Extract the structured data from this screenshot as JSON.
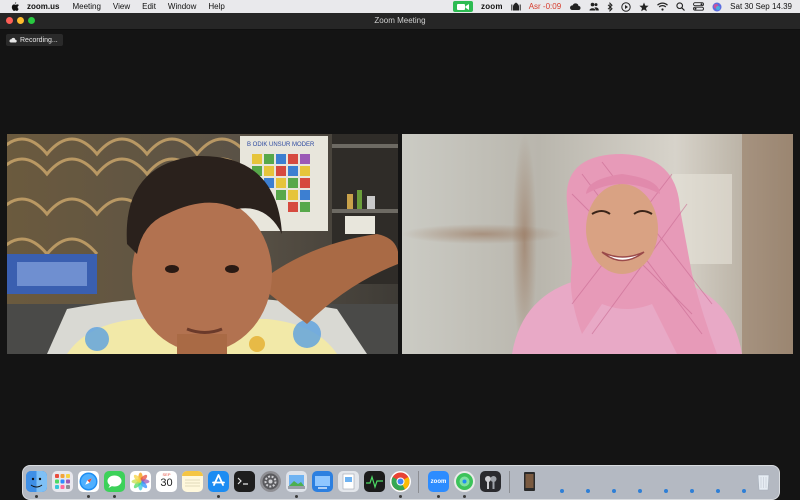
{
  "menubar": {
    "app_name": "zoom.us",
    "menus": [
      "Meeting",
      "View",
      "Edit",
      "Window",
      "Help"
    ],
    "status": {
      "zoom_label": "zoom",
      "prayer_time": "Asr -0:09",
      "date_time": "Sat 30 Sep  14.39"
    }
  },
  "window": {
    "title": "Zoom Meeting"
  },
  "meeting": {
    "recording_label": "Recording...",
    "left_poster_text": "B ODIK UNSUR MODER"
  },
  "dock": {
    "calendar": {
      "month": "SEP",
      "day": "30"
    },
    "zoom_icon_label": "zoom",
    "colors": {
      "finder": "#3f8fe6",
      "zoom": "#2d8cff"
    }
  }
}
